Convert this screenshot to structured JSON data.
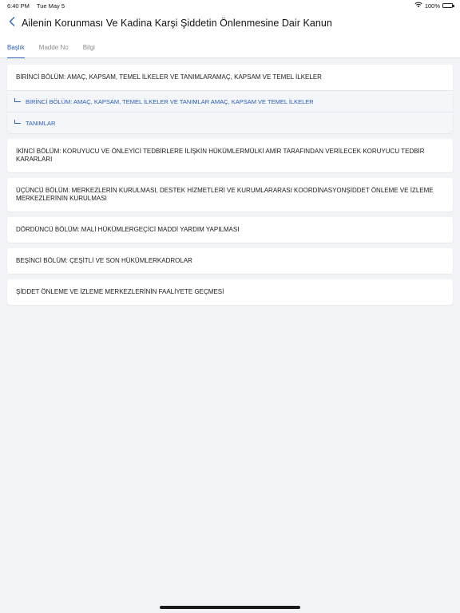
{
  "status_bar": {
    "time": "6:40 PM",
    "date": "Tue May 5",
    "battery": "100%",
    "icons": [
      "wifi-icon",
      "battery-icon"
    ]
  },
  "nav": {
    "back_icon": "chevron-left-icon",
    "title": "Ailenin Korunması Ve Kadina Karşi Şiddetin Önlenmesine Dair Kanun"
  },
  "tabs": [
    {
      "label": "Başlık",
      "active": true
    },
    {
      "label": "Madde No",
      "active": false
    },
    {
      "label": "Bilgi",
      "active": false
    }
  ],
  "sections": [
    {
      "title": "BİRİNCİ BÖLÜM: AMAÇ, KAPSAM, TEMEL İLKELER VE TANIMLARAMAÇ, KAPSAM VE TEMEL İLKELER",
      "children": [
        "BİRİNCİ BÖLÜM: AMAÇ, KAPSAM, TEMEL İLKELER VE TANIMLAR AMAÇ, KAPSAM VE TEMEL İLKELER",
        "TANIMLAR"
      ]
    },
    {
      "title": "İKİNCİ BÖLÜM: KORUYUCU VE ÖNLEYİCİ TEDBİRLERE İLİŞKİN HÜKÜMLERMÜLKİ AMİR TARAFINDAN VERİLECEK KORUYUCU TEDBİR KARARLARI"
    },
    {
      "title": "ÜÇÜNCÜ BÖLÜM: MERKEZLERİN KURULMASI, DESTEK HİZMETLERİ VE KURUMLARARASI KOORDİNASYONŞİDDET ÖNLEME VE İZLEME MERKEZLERİNİN KURULMASI"
    },
    {
      "title": "DÖRDÜNCÜ BÖLÜM: MALİ HÜKÜMLERGEÇİCİ MADDİ YARDIM YAPILMASI"
    },
    {
      "title": "BEŞİNCİ BÖLÜM: ÇEŞİTLİ VE SON HÜKÜMLERKADROLAR"
    },
    {
      "title": "ŞİDDET ÖNLEME VE İZLEME MERKEZLERİNİN FAALİYETE GEÇMESİ"
    }
  ],
  "colors": {
    "accent": "#2b5fb4",
    "background": "#f2f3f6",
    "card": "#ffffff"
  }
}
